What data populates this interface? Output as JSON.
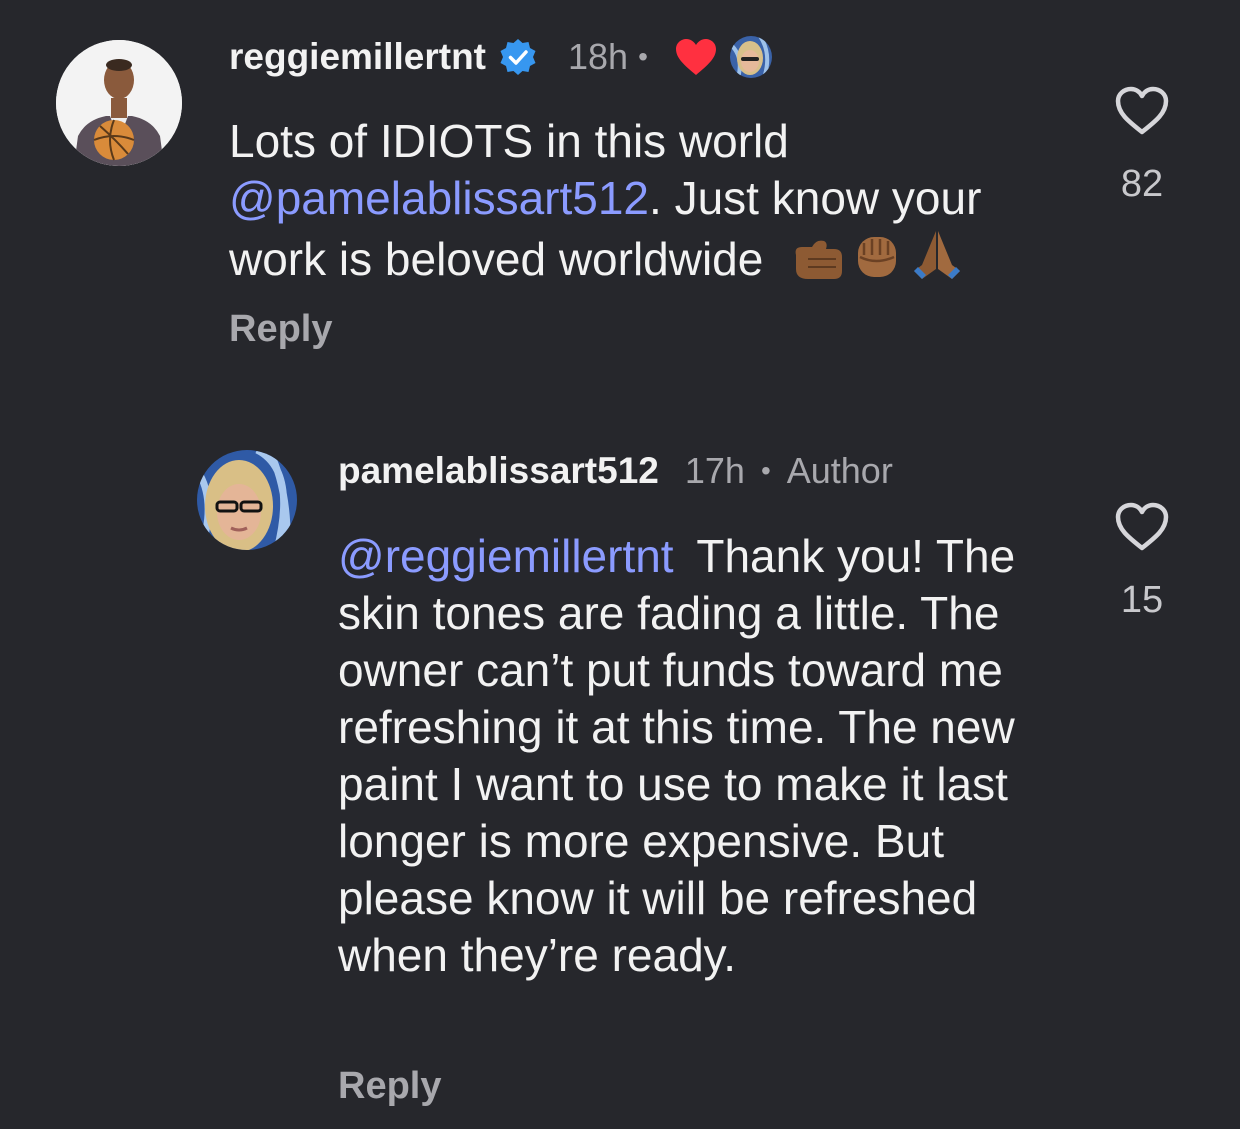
{
  "comments": [
    {
      "username": "reggiemillertnt",
      "verified": true,
      "time": "18h",
      "separator": "•",
      "liked_by_author": true,
      "text_before_mention": "Lots of IDIOTS in this world",
      "mention": "@pamelablissart512",
      "text_after_mention": ". Just know your work is beloved worldwide",
      "emojis": [
        "call-me-hand-emoji",
        "raised-fist-emoji",
        "folded-hands-emoji"
      ],
      "reply_label": "Reply",
      "like_count": "82",
      "icons": {
        "like": "heart-outline-icon",
        "verified": "verified-badge-icon",
        "author_like": "red-heart-icon"
      }
    },
    {
      "username": "pamelablissart512",
      "time": "17h",
      "separator": "•",
      "author_label": "Author",
      "mention": "@reggiemillertnt",
      "text": "Thank you! The skin tones are fading a little. The owner can’t put funds toward me refreshing it at this time. The new paint I want to use to make it last longer is more expensive. But please know it will be refreshed when they’re ready.",
      "reply_label": "Reply",
      "like_count": "15",
      "icons": {
        "like": "heart-outline-icon"
      }
    }
  ],
  "colors": {
    "background": "#26272c",
    "mention": "#8b9bff",
    "secondary_text": "#a8a8ad",
    "verified_badge": "#3797f0",
    "heart_red": "#ff3040"
  }
}
